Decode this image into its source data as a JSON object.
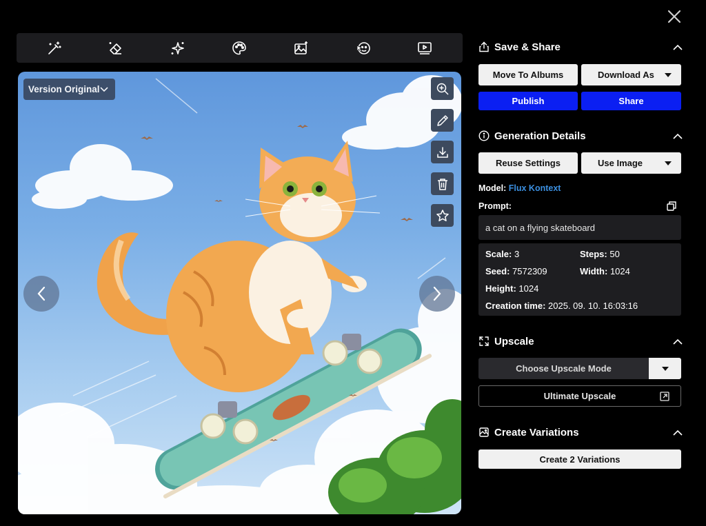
{
  "toolbar": {
    "tools": [
      {
        "icon": "magic-wand-icon"
      },
      {
        "icon": "eraser-icon"
      },
      {
        "icon": "sparkles-icon"
      },
      {
        "icon": "palette-icon"
      },
      {
        "icon": "image-sparkle-icon"
      },
      {
        "icon": "face-swap-icon"
      },
      {
        "icon": "video-icon"
      }
    ]
  },
  "viewer": {
    "version_label": "Version Original",
    "side_tools": [
      "zoom-in-icon",
      "pencil-icon",
      "download-icon",
      "trash-icon",
      "star-icon"
    ]
  },
  "save_share": {
    "title": "Save & Share",
    "move_to_albums": "Move To Albums",
    "download_as": "Download As",
    "publish": "Publish",
    "share": "Share"
  },
  "generation": {
    "title": "Generation Details",
    "reuse_settings": "Reuse Settings",
    "use_image": "Use Image",
    "model_label": "Model:",
    "model_value": "Flux Kontext",
    "prompt_label": "Prompt:",
    "prompt_text": "a cat on a flying skateboard",
    "details": {
      "scale_label": "Scale:",
      "scale_value": "3",
      "steps_label": "Steps:",
      "steps_value": "50",
      "seed_label": "Seed:",
      "seed_value": "7572309",
      "width_label": "Width:",
      "width_value": "1024",
      "height_label": "Height:",
      "height_value": "1024",
      "creation_label": "Creation time:",
      "creation_value": "2025. 09. 10. 16:03:16"
    }
  },
  "upscale": {
    "title": "Upscale",
    "mode_label": "Choose Upscale Mode",
    "ultimate_label": "Ultimate Upscale"
  },
  "variations": {
    "title": "Create Variations",
    "create_label": "Create 2 Variations"
  },
  "colors": {
    "background": "#000000",
    "toolbar": "#1c1c1f",
    "accent_blue": "#0b1ff2",
    "link_blue": "#3b8fe0"
  }
}
